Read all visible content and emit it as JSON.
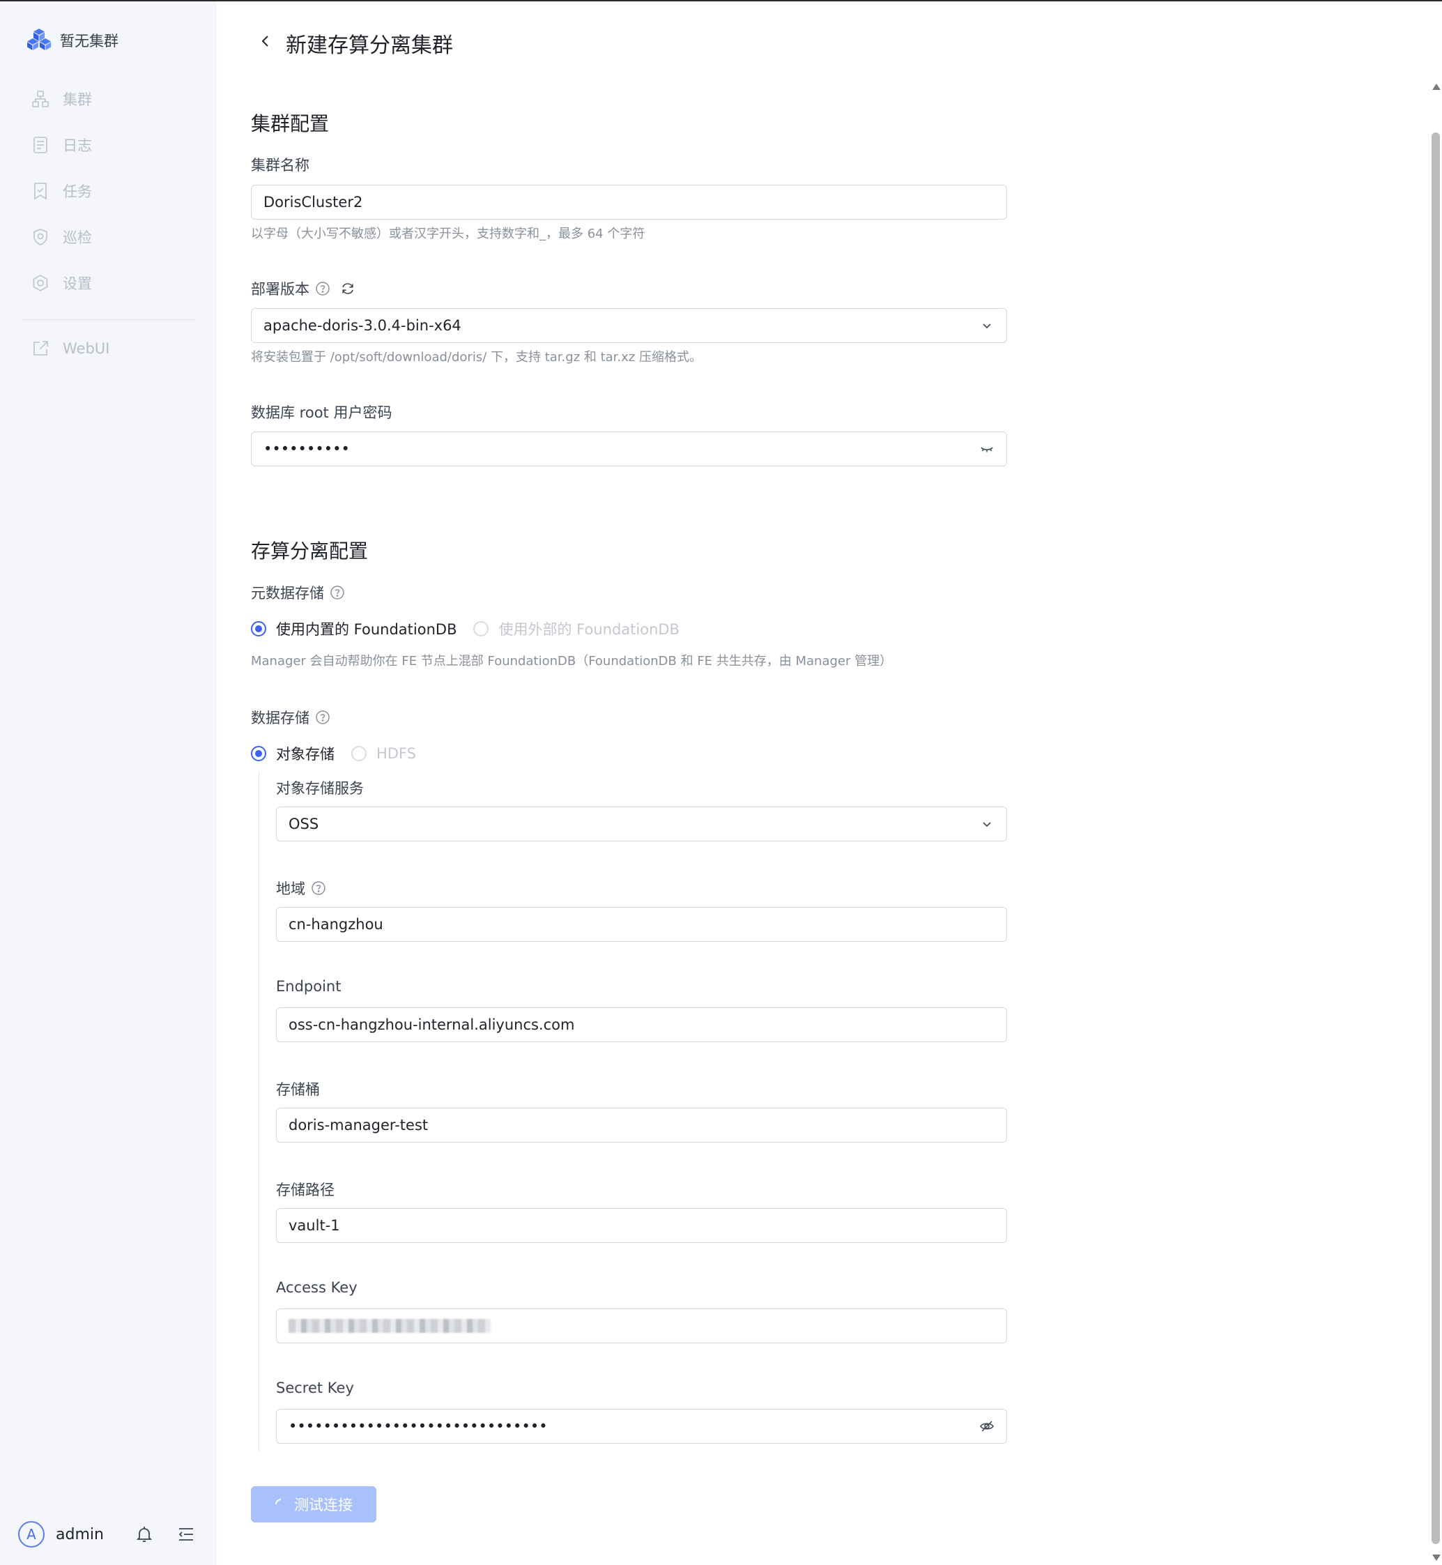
{
  "sidebar": {
    "brand": "暂无集群",
    "items": [
      {
        "label": "集群",
        "icon": "cluster-icon"
      },
      {
        "label": "日志",
        "icon": "log-icon"
      },
      {
        "label": "任务",
        "icon": "task-icon"
      },
      {
        "label": "巡检",
        "icon": "inspection-shield-icon"
      },
      {
        "label": "设置",
        "icon": "gear-icon"
      }
    ],
    "webui": {
      "label": "WebUI",
      "icon": "external-link-icon"
    },
    "user": {
      "avatar_letter": "A",
      "name": "admin"
    }
  },
  "page": {
    "title": "新建存算分离集群"
  },
  "cluster_config": {
    "section_title": "集群配置",
    "name_label": "集群名称",
    "name_value": "DorisCluster2",
    "name_hint": "以字母（大小写不敏感）或者汉字开头，支持数字和_，最多 64 个字符",
    "version_label": "部署版本",
    "version_value": "apache-doris-3.0.4-bin-x64",
    "version_hint": "将安装包置于 /opt/soft/download/doris/ 下，支持 tar.gz 和 tar.xz 压缩格式。",
    "password_label": "数据库 root 用户密码",
    "password_value": "••••••••••"
  },
  "storage_config": {
    "section_title": "存算分离配置",
    "meta_label": "元数据存储",
    "meta_options": [
      "使用内置的 FoundationDB",
      "使用外部的 FoundationDB"
    ],
    "meta_selected": 0,
    "meta_hint": "Manager 会自动帮助你在 FE 节点上混部 FoundationDB（FoundationDB 和 FE 共生共存，由 Manager 管理）",
    "data_label": "数据存储",
    "data_options": [
      "对象存储",
      "HDFS"
    ],
    "data_selected": 0,
    "service_label": "对象存储服务",
    "service_value": "OSS",
    "region_label": "地域",
    "region_value": "cn-hangzhou",
    "endpoint_label": "Endpoint",
    "endpoint_value": "oss-cn-hangzhou-internal.aliyuncs.com",
    "bucket_label": "存储桶",
    "bucket_value": "doris-manager-test",
    "path_label": "存储路径",
    "path_value": "vault-1",
    "access_key_label": "Access Key",
    "secret_key_label": "Secret Key",
    "secret_key_value": "••••••••••••••••••••••••••••••"
  },
  "actions": {
    "test_connection": "测试连接"
  },
  "colors": {
    "accent": "#3b63f5",
    "sidebar_bg": "#f4f6fb",
    "button_disabled": "#a8c0fb"
  }
}
